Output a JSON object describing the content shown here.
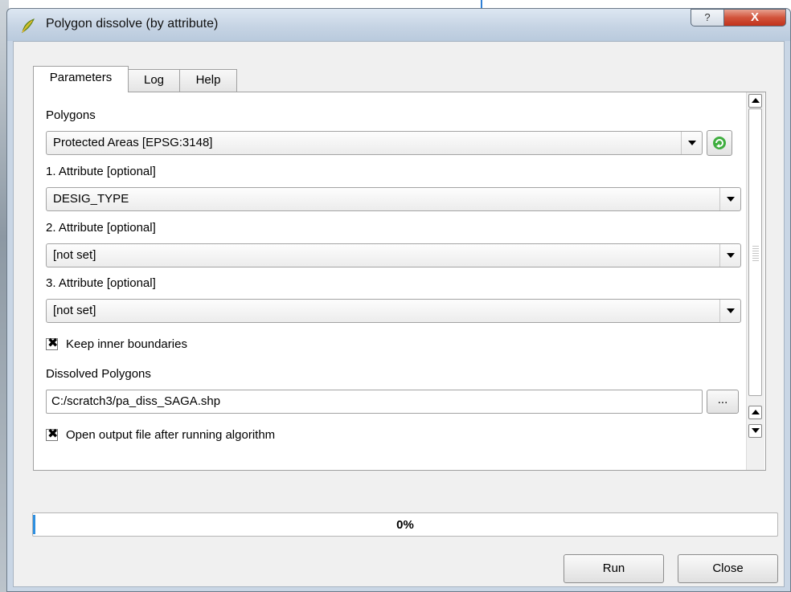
{
  "window": {
    "title": "Polygon dissolve (by attribute)",
    "help_glyph": "?",
    "close_glyph": "X"
  },
  "tabs": [
    {
      "label": "Parameters",
      "active": true
    },
    {
      "label": "Log",
      "active": false
    },
    {
      "label": "Help",
      "active": false
    }
  ],
  "parameters": {
    "polygons_label": "Polygons",
    "polygons_value": "Protected Areas [EPSG:3148]",
    "attr1_label": "1. Attribute [optional]",
    "attr1_value": "DESIG_TYPE",
    "attr2_label": "2. Attribute [optional]",
    "attr2_value": "[not set]",
    "attr3_label": "3. Attribute [optional]",
    "attr3_value": "[not set]",
    "keep_inner_label": "Keep inner boundaries",
    "keep_inner_checked": true,
    "dissolved_label": "Dissolved Polygons",
    "dissolved_path": "C:/scratch3/pa_diss_SAGA.shp",
    "browse_label": "...",
    "open_output_label": "Open output file after running algorithm",
    "open_output_checked": true,
    "checkbox_mark": "✖"
  },
  "progress": {
    "value": 0,
    "text": "0%"
  },
  "buttons": {
    "run": "Run",
    "close": "Close"
  },
  "colors": {
    "accent": "#2d8fe0",
    "titlebar": "#c6d4e4",
    "close_red": "#c1321b"
  }
}
